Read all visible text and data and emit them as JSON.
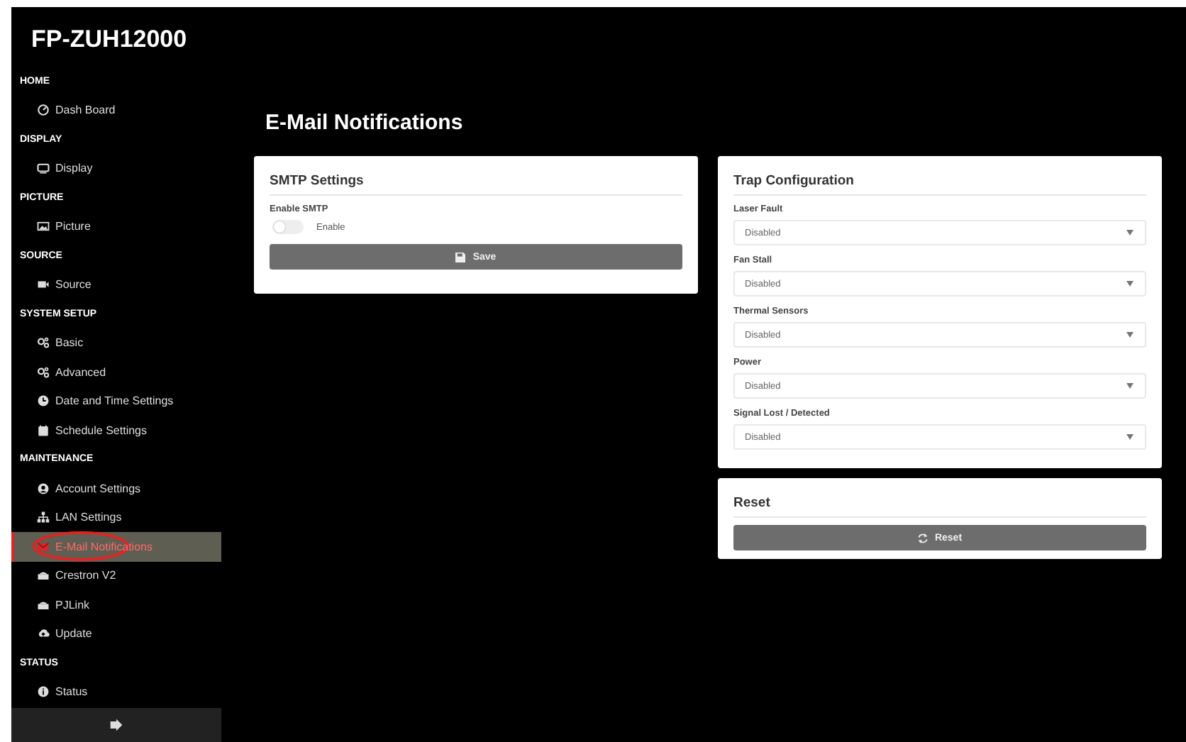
{
  "sidebar": {
    "title": "FP-ZUH12000",
    "sections": [
      {
        "heading": "HOME",
        "items": [
          {
            "label": "Dash Board",
            "selected": false
          }
        ]
      },
      {
        "heading": "DISPLAY",
        "items": [
          {
            "label": "Display",
            "selected": false
          }
        ]
      },
      {
        "heading": "PICTURE",
        "items": [
          {
            "label": "Picture",
            "selected": false
          }
        ]
      },
      {
        "heading": "SOURCE",
        "items": [
          {
            "label": "Source",
            "selected": false
          }
        ]
      },
      {
        "heading": "SYSTEM SETUP",
        "items": [
          {
            "label": "Basic",
            "selected": false
          },
          {
            "label": "Advanced",
            "selected": false
          },
          {
            "label": "Date and Time Settings",
            "selected": false
          },
          {
            "label": "Schedule Settings",
            "selected": false
          }
        ]
      },
      {
        "heading": "MAINTENANCE",
        "items": [
          {
            "label": "Account Settings",
            "selected": false
          },
          {
            "label": "LAN Settings",
            "selected": false
          },
          {
            "label": "E-Mail Notifications",
            "selected": true
          },
          {
            "label": "Crestron V2",
            "selected": false
          },
          {
            "label": "PJLink",
            "selected": false
          },
          {
            "label": "Update",
            "selected": false
          }
        ]
      },
      {
        "heading": "STATUS",
        "items": [
          {
            "label": "Status",
            "selected": false
          }
        ]
      }
    ]
  },
  "page_title": "E-Mail Notifications",
  "smtp": {
    "title": "SMTP Settings",
    "field_label": "Enable SMTP",
    "toggle": {
      "label": "Enable",
      "on": false
    },
    "button": "Save"
  },
  "trap": {
    "title": "Trap Configuration",
    "fields": [
      {
        "label": "Laser Fault",
        "value": "Disabled"
      },
      {
        "label": "Fan Stall",
        "value": "Disabled"
      },
      {
        "label": "Thermal Sensors",
        "value": "Disabled"
      },
      {
        "label": "Power",
        "value": "Disabled"
      },
      {
        "label": "Signal Lost / Detected",
        "value": "Disabled"
      }
    ]
  },
  "reset": {
    "title": "Reset",
    "button": "Reset"
  }
}
